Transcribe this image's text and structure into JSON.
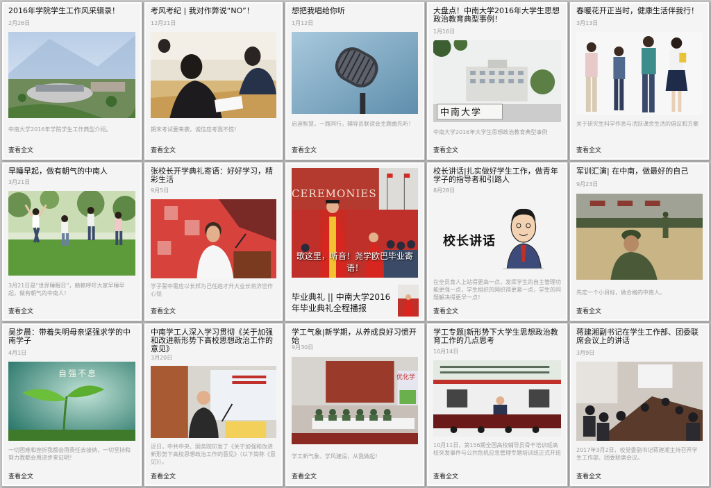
{
  "read_more": "查看全文",
  "cards": [
    {
      "title": "2016年学院学生工作风采辑录！",
      "date": "2月26日",
      "excerpt": "中南大学2016年学院学生工作典型介绍。",
      "image": "campus-aerial-photo"
    },
    {
      "title": "考风考纪 | 我对作弊说“NO”！",
      "date": "12月21日",
      "excerpt": "期末考试要来袭，诚信应考我不慌！",
      "image": "students-taking-exam-photo"
    },
    {
      "title": "想把我唱给你听",
      "date": "1月12日",
      "excerpt": "启迪智慧，一路同行，辅导员联谊会主题曲先听！",
      "image": "microphone-photo"
    },
    {
      "title": "大盘点！中南大学2016年大学生思想政治教育典型事例！",
      "date": "1月16日",
      "excerpt": "中南大学2016年大学生思想政治教育典型事例",
      "image": "campus-gate-photo",
      "image_text": "中南大学"
    },
    {
      "title": "春暖花开正当时，健康生活伴我行！",
      "date": "3月13日",
      "excerpt": "关于研究生科学作息与活跃课余生活的倡议和方案",
      "image": "students-standing-photo"
    },
    {
      "title": "早睡早起，做有朝气的中南人",
      "date": "3月21日",
      "excerpt": "3月21日是“世界睡眠日”，赖赖呼吁大家早睡早起，做有朝气的中南人！",
      "image": "students-jumping-photo"
    },
    {
      "title": "张校长开学典礼寄语：好好学习，精彩生活",
      "date": "9月5日",
      "excerpt": "学子誓中需应以长邦为己任趋才升大业长将济世作心铭",
      "image": "president-speech-photo"
    },
    {
      "title": "",
      "date": "",
      "excerpt": "",
      "image": "graduation-ceremony-photo",
      "image_text": "CEREMONIES",
      "caption": "歌这里，听音！尧学欧巴毕业寄语！",
      "headline": "毕业典礼 || 中南大学2016年毕业典礼全程播报"
    },
    {
      "title": "校长讲话|扎实做好学生工作，做青年学子的指导者和引路人",
      "date": "8月28日",
      "excerpt": "在全员育人上站得更高一点，发挥学生的自主管理功能更强一点，学生组织的网织得更紧一点，学生的问题解决得更早一点！",
      "image": "president-cartoon-illustration",
      "image_text": "校长讲话"
    },
    {
      "title": "军训汇演| 在中南，做最好的自己",
      "date": "9月23日",
      "excerpt": "先定一个小目标，做合格的中南人。",
      "image": "military-training-photo"
    },
    {
      "title": "吴步晨：带着失明母亲坚强求学的中南学子",
      "date": "4月1日",
      "excerpt": "一切困难和挫折我都会用责任去接纳，一切坚持和努力我都会用进步来证明！",
      "image": "seedling-illustration",
      "image_text": "自强不息"
    },
    {
      "title": "中南学工人深入学习贯彻《关于加强和改进新形势下高校思想政治工作的意见》",
      "date": "3月20日",
      "excerpt": "近日，中共中央、国务院印发了《关于加强和改进新形势下高校思想政治工作的意见》（以下简称《意见》）。",
      "image": "lecture-speaker-photo"
    },
    {
      "title": "学工气象|新学期，从养成良好习惯开始",
      "date": "9月30日",
      "excerpt": "学工新气象、学风建设，从我做起！",
      "image": "meeting-hall-photo",
      "image_text": "优化学"
    },
    {
      "title": "学工专题|新形势下大学生思想政治教育工作的几点思考",
      "date": "10月14日",
      "excerpt": "10月11日，第156期全国高校辅导员骨干培训班高校突发事件与公共危机应急管理专题培训班正式开班",
      "image": "training-conference-photo"
    },
    {
      "title": "蒋建湘副书记在学生工作部、团委联席会议上的讲话",
      "date": "3月9日",
      "excerpt": "2017年3月2日，校党委副书记蒋建湘主持召开学生工作部、团委联席会议。",
      "image": "joint-meeting-photo"
    }
  ]
}
